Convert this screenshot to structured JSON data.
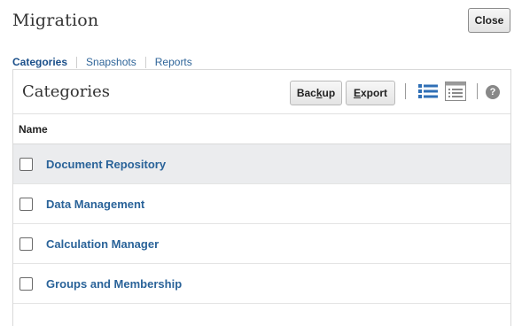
{
  "page": {
    "title": "Migration",
    "close_label": "Close"
  },
  "tabs": [
    {
      "label": "Categories",
      "active": true
    },
    {
      "label": "Snapshots",
      "active": false
    },
    {
      "label": "Reports",
      "active": false
    }
  ],
  "panel": {
    "title": "Categories",
    "toolbar": {
      "backup_prefix": "Bac",
      "backup_mnemonic": "k",
      "backup_suffix": "up",
      "export_mnemonic": "E",
      "export_suffix": "xport",
      "icons": [
        "list-view-icon",
        "table-view-icon",
        "help-icon"
      ],
      "help_glyph": "?"
    },
    "table": {
      "column_header": "Name",
      "rows": [
        {
          "label": "Document Repository",
          "checked": false,
          "highlighted": true
        },
        {
          "label": "Data Management",
          "checked": false,
          "highlighted": false
        },
        {
          "label": "Calculation Manager",
          "checked": false,
          "highlighted": false
        },
        {
          "label": "Groups and Membership",
          "checked": false,
          "highlighted": false
        }
      ]
    }
  },
  "colors": {
    "link": "#2a6399",
    "tab_active": "#1a4f8a",
    "selected_row": "#ebecee",
    "icon_blue": "#2f6fb6"
  }
}
